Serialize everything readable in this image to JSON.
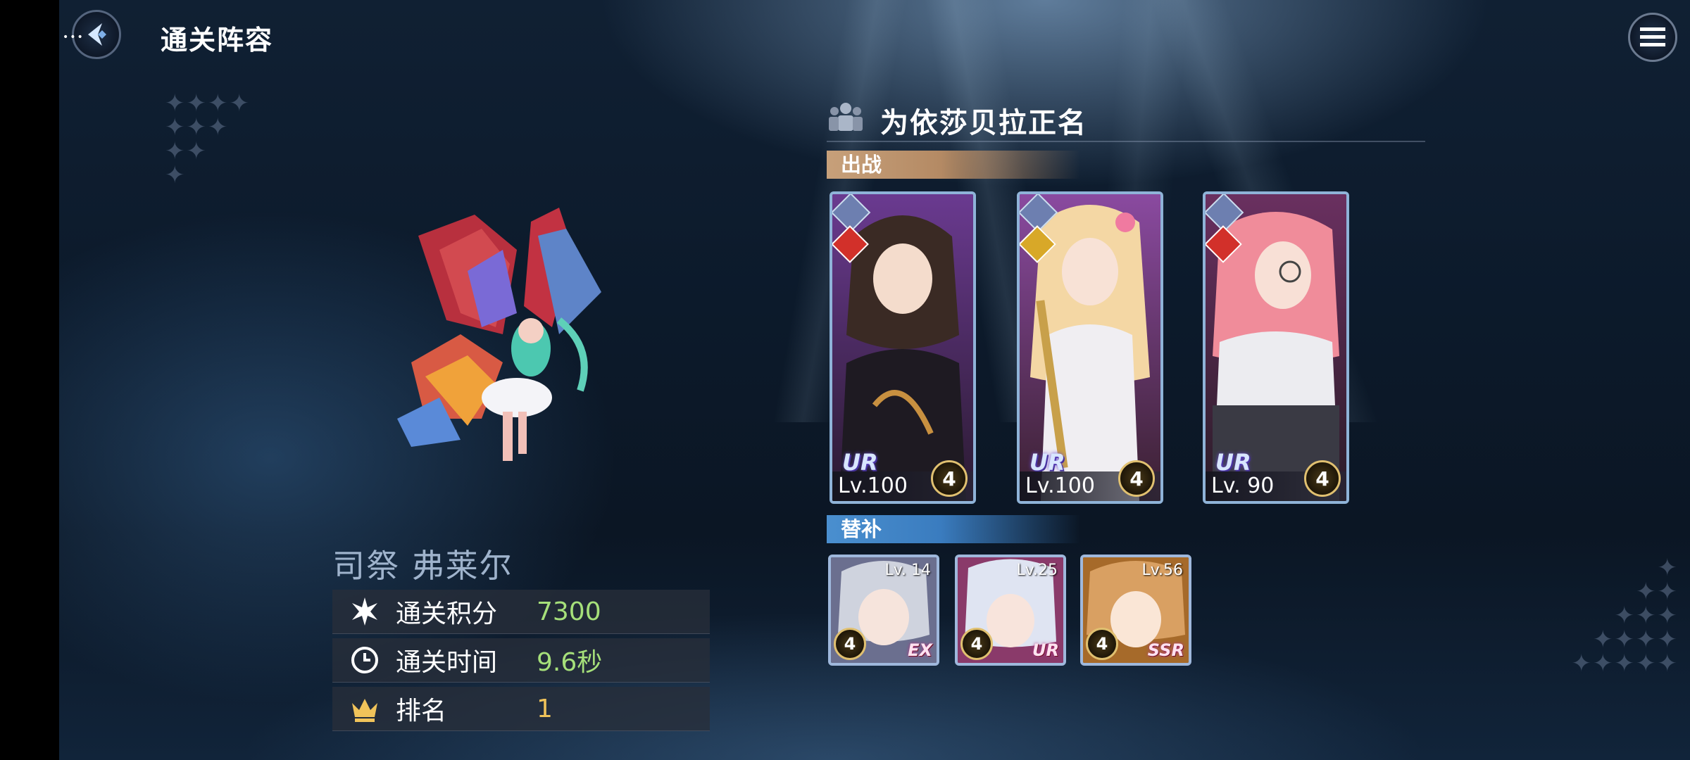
{
  "header": {
    "title": "通关阵容",
    "back_icon": "back-arrow-icon",
    "menu_icon": "menu-icon"
  },
  "boss": {
    "name": "司祭 弗莱尔",
    "sprite": "fairy-sprite"
  },
  "stats": [
    {
      "icon": "burst-icon",
      "label": "通关积分",
      "value": "7300",
      "color": "#a6e07a"
    },
    {
      "icon": "clock-icon",
      "label": "通关时间",
      "value": "9.6秒",
      "color": "#a6e07a"
    },
    {
      "icon": "crown-icon",
      "label": "排名",
      "value": "1",
      "color": "#f0c35a"
    }
  ],
  "team": {
    "icon": "team-icon",
    "name": "为依莎贝拉正名",
    "main_label": "出战",
    "sub_label": "替补",
    "main": [
      {
        "rarity": "UR",
        "level": "Lv.100",
        "stars": "4",
        "element": "fire",
        "hair": "#3a2a24",
        "bg": "#5a2e7a"
      },
      {
        "rarity": "UR",
        "level": "Lv.100",
        "stars": "4",
        "element": "light",
        "hair": "#f4d7a4",
        "bg": "#7a3a8c"
      },
      {
        "rarity": "UR",
        "level": "Lv. 90",
        "stars": "4",
        "element": "fire",
        "hair": "#f08c9a",
        "bg": "#5c2a5a"
      }
    ],
    "subs": [
      {
        "rarity": "EX",
        "level": "Lv. 14",
        "stars": "4",
        "hair": "#cfd3de",
        "bg": "#6b6f8f"
      },
      {
        "rarity": "UR",
        "level": "Lv.25",
        "stars": "4",
        "hair": "#dfe4f2",
        "bg": "#8a3a6a"
      },
      {
        "rarity": "SSR",
        "level": "Lv.56",
        "stars": "4",
        "hair": "#d9a062",
        "bg": "#a66a2a"
      }
    ]
  },
  "colors": {
    "accent_gold": "#c7a07a",
    "accent_blue": "#4a8fcf",
    "stat_green": "#a6e07a",
    "rank_gold": "#f0c35a"
  }
}
